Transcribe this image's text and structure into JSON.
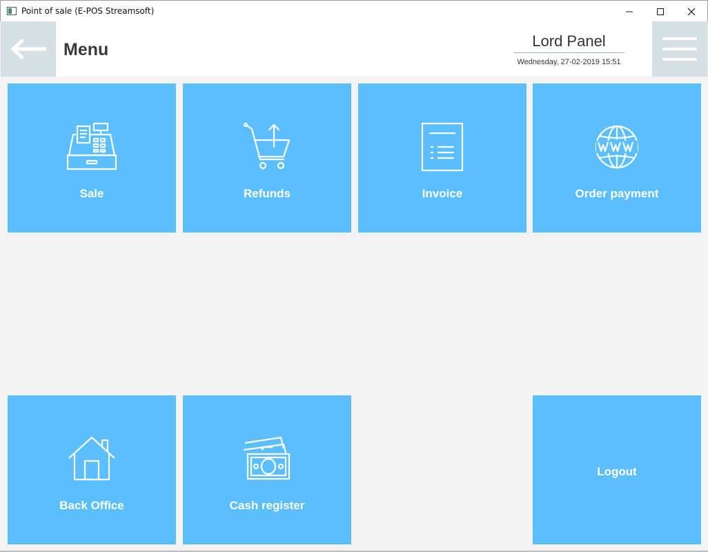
{
  "window": {
    "title": "Point of sale (E-POS Streamsoft)",
    "controls": [
      "minimize-icon",
      "maximize-icon",
      "close-icon"
    ]
  },
  "header": {
    "back_icon": "arrow-left-icon",
    "title": "Menu",
    "user_name": "Lord Panel",
    "datetime": "Wednesday, 27-02-2019 15:51",
    "menu_icon": "hamburger-icon"
  },
  "tiles": [
    {
      "label": "Sale",
      "icon": "cash-register-icon"
    },
    {
      "label": "Refunds",
      "icon": "cart-return-icon"
    },
    {
      "label": "Invoice",
      "icon": "document-list-icon"
    },
    {
      "label": "Order payment",
      "icon": "globe-www-icon"
    },
    {
      "label": "Back Office",
      "icon": "house-icon"
    },
    {
      "label": "Cash register",
      "icon": "banknotes-icon"
    },
    {
      "label": "Logout",
      "icon": ""
    }
  ],
  "colors": {
    "tile": "#5bbfff",
    "background": "#f3f3f3",
    "header_button": "#d6e0e4",
    "title_text": "#3a3a3a"
  }
}
